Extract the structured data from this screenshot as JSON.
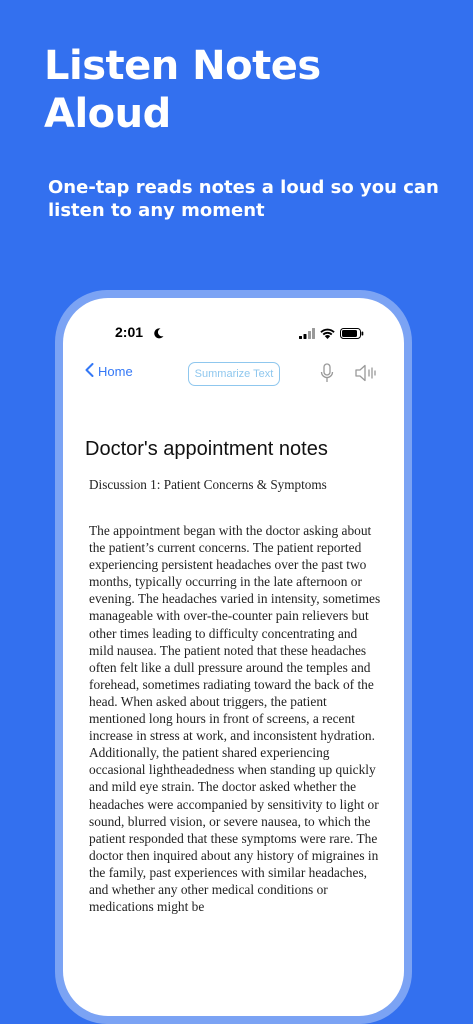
{
  "promo": {
    "headline": "Listen Notes Aloud",
    "subline": "One-tap reads notes a loud so you can listen to any moment"
  },
  "status_bar": {
    "time": "2:01",
    "icons": [
      "moon-icon",
      "signal-icon",
      "wifi-icon",
      "battery-icon"
    ]
  },
  "nav": {
    "back_label": "Home",
    "summarize_label": "Summarize Text",
    "icons": [
      "chevron-left-icon",
      "microphone-icon",
      "speaker-icon"
    ]
  },
  "note": {
    "title": "Doctor's appointment notes",
    "subtitle": "Discussion 1: Patient Concerns & Symptoms",
    "body": "The appointment began with the doctor asking about the patient’s current concerns. The patient reported experiencing persistent headaches over the past two months, typically occurring in the late afternoon or evening. The headaches varied in intensity, sometimes manageable with over-the-counter pain relievers but other times leading to difficulty concentrating and mild nausea. The patient noted that these headaches often felt like a dull pressure around the temples and forehead, sometimes radiating toward the back of the head. When asked about triggers, the patient mentioned long hours in front of screens, a recent increase in stress at work, and inconsistent hydration. Additionally, the patient shared experiencing occasional lightheadedness when standing up quickly and mild eye strain. The doctor asked whether the headaches were accompanied by sensitivity to light or sound, blurred vision, or severe nausea, to which the patient responded that these symptoms were rare. The doctor then inquired about any history of migraines in the family, past experiences with similar headaches, and whether any other medical conditions or medications might be"
  },
  "colors": {
    "background": "#3370EF",
    "phone_frame": "#7BA3F4",
    "accent": "#3478F6",
    "summarize_border": "#8FC7EE"
  }
}
